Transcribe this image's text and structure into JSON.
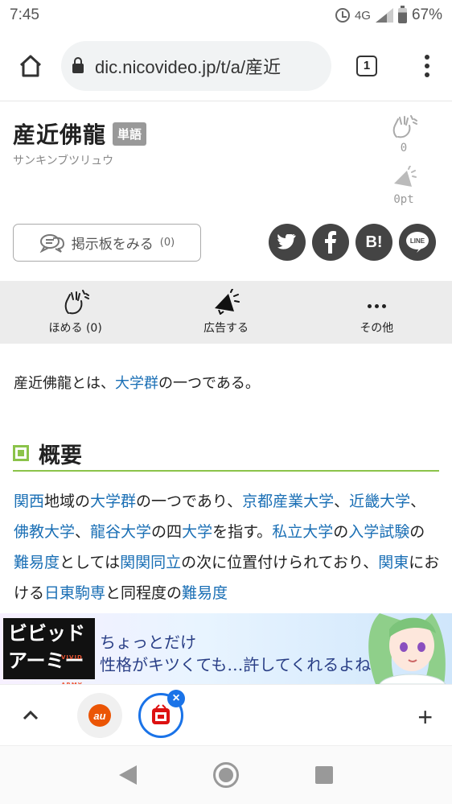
{
  "status_bar": {
    "time": "7:45",
    "network": "4G",
    "battery": "67%"
  },
  "browser": {
    "url": "dic.nicovideo.jp/t/a/産近",
    "tab_count": "1"
  },
  "article": {
    "title": "産近佛龍",
    "badge": "単語",
    "reading": "サンキンブツリュウ",
    "praise_count": "0",
    "ad_points": "0pt",
    "board_button": {
      "label": "掲示板をみる",
      "count": "(0)"
    },
    "share": [
      "twitter",
      "facebook",
      "hatena",
      "line"
    ],
    "share_labels": {
      "hatena": "B!",
      "line": "LINE"
    }
  },
  "action_bar": {
    "praise_label": "ほめる",
    "praise_count": "(0)",
    "advertise_label": "広告する",
    "other_label": "その他"
  },
  "body": {
    "intro": {
      "pre": "産近佛龍とは、",
      "link": "大学群",
      "post": "の一つである。"
    },
    "section_title": "概要",
    "paragraph": [
      {
        "t": "関西",
        "link": true
      },
      {
        "t": "地域の",
        "link": false
      },
      {
        "t": "大学群",
        "link": true
      },
      {
        "t": "の一つであり、",
        "link": false
      },
      {
        "t": "京都産業大学",
        "link": true
      },
      {
        "t": "、",
        "link": false
      },
      {
        "t": "近畿大学",
        "link": true
      },
      {
        "t": "、",
        "link": false
      },
      {
        "t": "佛教大学",
        "link": true
      },
      {
        "t": "、",
        "link": false
      },
      {
        "t": "龍谷大学",
        "link": true
      },
      {
        "t": "の四",
        "link": false
      },
      {
        "t": "大学",
        "link": true
      },
      {
        "t": "を指す。",
        "link": false
      },
      {
        "t": "私立大学",
        "link": true
      },
      {
        "t": "の",
        "link": false
      },
      {
        "t": "入学試験",
        "link": true
      },
      {
        "t": "の",
        "link": false
      },
      {
        "t": "難易度",
        "link": true
      },
      {
        "t": "としては",
        "link": false
      },
      {
        "t": "関関同立",
        "link": true
      },
      {
        "t": "の次に位置付けられており、",
        "link": false
      },
      {
        "t": "関東",
        "link": true
      },
      {
        "t": "における",
        "link": false
      },
      {
        "t": "日東駒専",
        "link": true
      },
      {
        "t": "と同程度の",
        "link": false
      },
      {
        "t": "難易度",
        "link": true
      }
    ]
  },
  "ad": {
    "logo_line1": "ビビッド",
    "logo_line2": "アーミー",
    "logo_small": "VIVID ARMY",
    "line1": "ちょっとだけ",
    "line2": "性格がキツくても…許してくれるよね?"
  },
  "tab_strip": {
    "tab1_icon": "au-favicon",
    "tab2_icon": "nicopedia-favicon"
  },
  "colors": {
    "link": "#1a6fb5",
    "section_accent": "#8bc34a",
    "active_tab": "#1a73e8"
  }
}
